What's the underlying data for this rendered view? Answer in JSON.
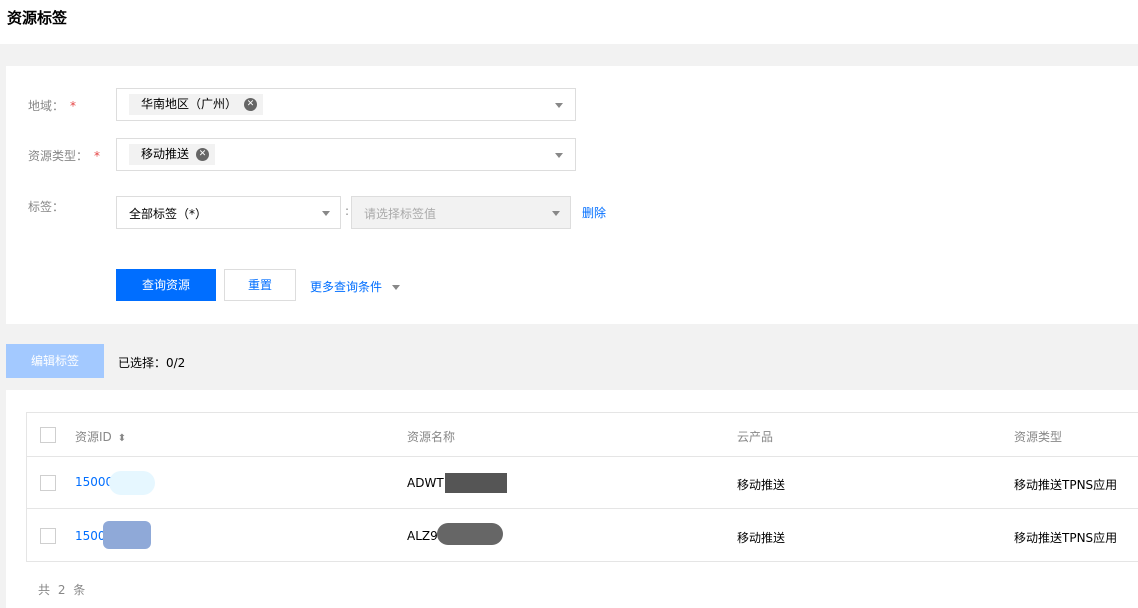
{
  "page": {
    "title": "资源标签"
  },
  "filters": {
    "region": {
      "label": "地域：",
      "required_mark": "*",
      "chip": "华南地区（广州）"
    },
    "resource_type": {
      "label": "资源类型：",
      "required_mark": "*",
      "chip": "移动推送"
    },
    "tag": {
      "label": "标签：",
      "key_value": "全部标签（*）",
      "separator": ":",
      "value_placeholder": "请选择标签值",
      "delete_label": "删除"
    }
  },
  "actions": {
    "query_label": "查询资源",
    "reset_label": "重置",
    "more_label": "更多查询条件",
    "edit_tags_label": "编辑标签",
    "selected_label": "已选择：0/2"
  },
  "table": {
    "columns": [
      "资源ID",
      "资源名称",
      "云产品",
      "资源类型"
    ],
    "rows": [
      {
        "id": "15000",
        "name": "ADWT",
        "product": "移动推送",
        "type": "移动推送TPNS应用"
      },
      {
        "id": "1500",
        "name": "ALZ9",
        "product": "移动推送",
        "type": "移动推送TPNS应用"
      }
    ],
    "footer": "共 2 条"
  },
  "colors": {
    "primary": "#006eff",
    "disabled_primary": "#a3c9ff",
    "required": "#e54545"
  }
}
